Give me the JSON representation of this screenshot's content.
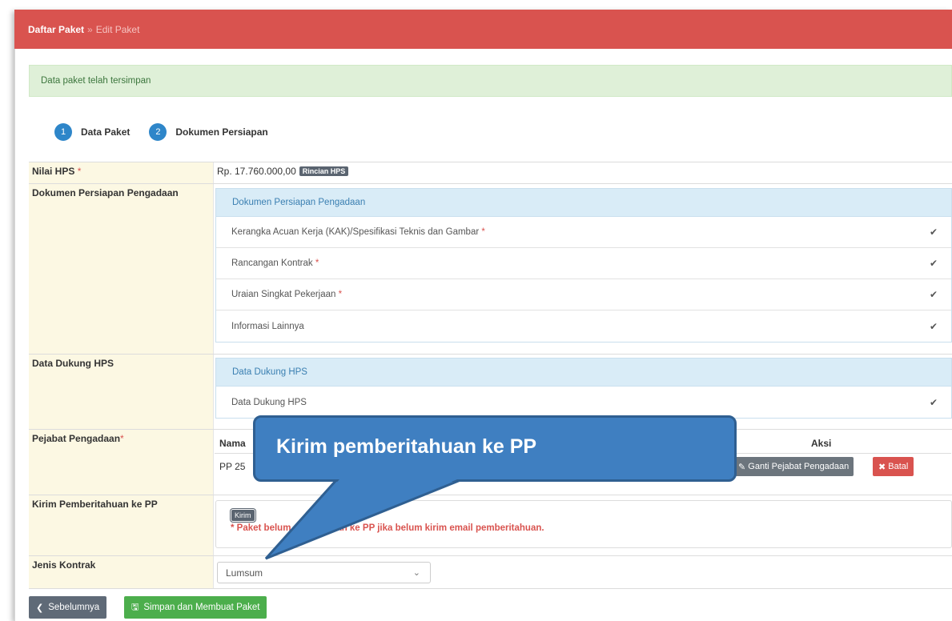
{
  "breadcrumb": {
    "parent": "Daftar Paket",
    "separator": "»",
    "current": "Edit Paket"
  },
  "alert": {
    "text": "Data paket telah tersimpan"
  },
  "steps": [
    {
      "number": "1",
      "label": "Data Paket"
    },
    {
      "number": "2",
      "label": "Dokumen Persiapan"
    }
  ],
  "nilai_hps": {
    "label": "Nilai HPS",
    "required": "*",
    "value": "Rp. 17.760.000,00",
    "detail_button": "Rincian HPS"
  },
  "dokumen_persiapan": {
    "label": "Dokumen Persiapan Pengadaan",
    "panel_title": "Dokumen Persiapan Pengadaan",
    "items": [
      {
        "text": "Kerangka Acuan Kerja (KAK)/Spesifikasi Teknis dan Gambar",
        "required": "*"
      },
      {
        "text": "Rancangan Kontrak",
        "required": "*"
      },
      {
        "text": "Uraian Singkat Pekerjaan",
        "required": "*"
      },
      {
        "text": "Informasi Lainnya",
        "required": ""
      }
    ]
  },
  "data_dukung": {
    "label": "Data Dukung HPS",
    "panel_title": "Data Dukung HPS",
    "items": [
      {
        "text": "Data Dukung HPS"
      }
    ]
  },
  "pejabat": {
    "label": "Pejabat Pengadaan",
    "required": "*",
    "col_nama": "Nama",
    "col_aksi": "Aksi",
    "row_name": "PP 25",
    "change_button": "Ganti Pejabat Pengadaan",
    "cancel_button": "Batal"
  },
  "kirim": {
    "label": "Kirim Pemberitahuan ke PP",
    "button": "Kirim",
    "warning": "* Paket belum ditayangkan ke PP jika belum kirim email pemberitahuan."
  },
  "jenis_kontrak": {
    "label": "Jenis Kontrak",
    "selected": "Lumsum"
  },
  "footer": {
    "prev_button": "Sebelumnya",
    "save_button": "Simpan dan Membuat Paket"
  },
  "callout": {
    "text": "Kirim pemberitahuan ke PP"
  },
  "colors": {
    "header_red": "#d9534f",
    "step_blue": "#2e86c9",
    "success_bg": "#dff0d8",
    "callout_blue": "#3f7fc1",
    "save_green": "#4cae4c"
  }
}
